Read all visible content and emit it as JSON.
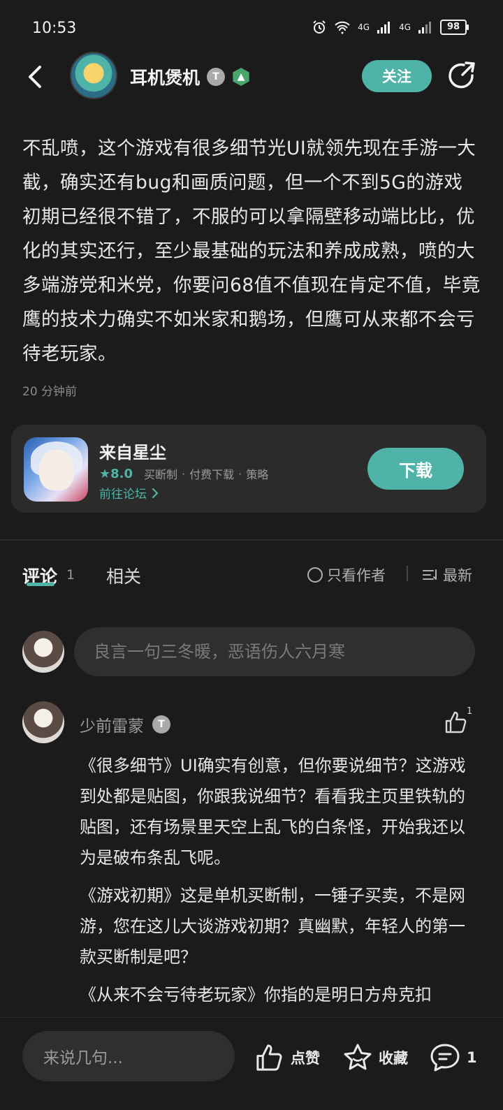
{
  "status_bar": {
    "time": "10:53",
    "network_1": "4G",
    "network_2": "4G",
    "battery": "98"
  },
  "header": {
    "username": "耳机煲机",
    "level_badge": "T",
    "follow_label": "关注"
  },
  "post": {
    "text": "不乱喷，这个游戏有很多细节光UI就领先现在手游一大截，确实还有bug和画质问题，但一个不到5G的游戏初期已经很不错了，不服的可以拿隔壁移动端比比，优化的其实还行，至少最基础的玩法和养成成熟，喷的大多端游党和米党，你要问68值不值现在肯定不值，毕竟鹰的技术力确实不如米家和鹅场，但鹰可从来都不会亏待老玩家。",
    "time": "20 分钟前"
  },
  "game_card": {
    "title": "来自星尘",
    "score": "8.0",
    "tags": [
      "买断制",
      "付费下载",
      "策略"
    ],
    "dot": "·",
    "forum_link": "前往论坛",
    "download_label": "下载"
  },
  "tabs": {
    "comments": "评论",
    "comments_count": "1",
    "related": "相关",
    "author_only": "只看作者",
    "sort": "最新"
  },
  "comment_input": {
    "placeholder": "良言一句三冬暖，恶语伤人六月寒"
  },
  "comment": {
    "username": "少前雷蒙",
    "level_badge": "T",
    "likes": "1",
    "paragraphs": [
      "《很多细节》UI确实有创意，但你要说细节？这游戏到处都是贴图，你跟我说细节？看看我主页里铁轨的贴图，还有场景里天空上乱飞的白条怪，开始我还以为是破布条乱飞呢。",
      "《游戏初期》这是单机买断制，一锤子买卖，不是网游，您在这儿大谈游戏初期？真幽默，年轻人的第一款买断制是吧？",
      "《从来不会亏待老玩家》你指的是明日方舟克扣"
    ]
  },
  "bottom_bar": {
    "input_placeholder": "来说几句...",
    "like_label": "点赞",
    "fav_label": "收藏",
    "comment_count": "1"
  }
}
